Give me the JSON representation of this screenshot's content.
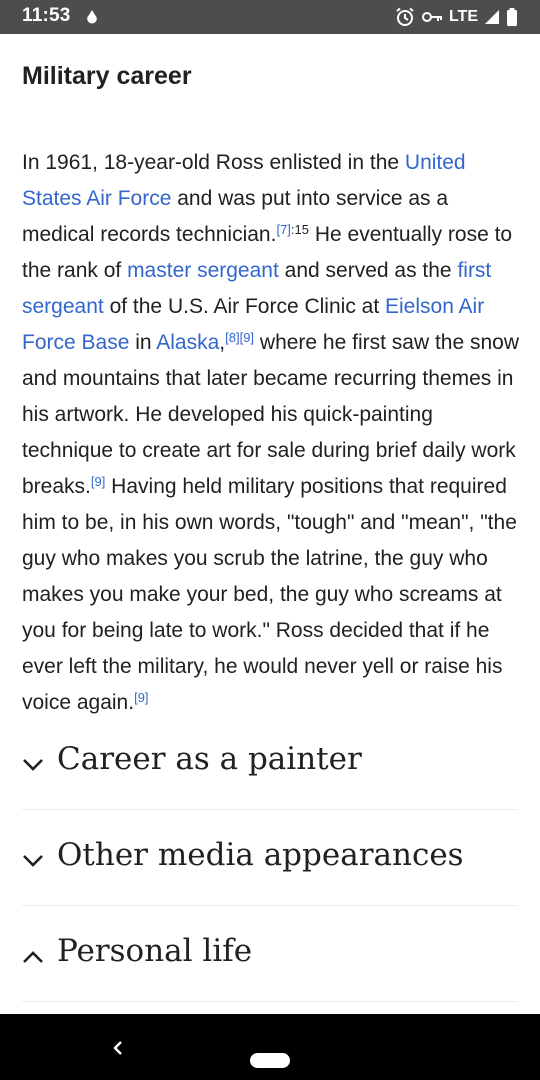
{
  "status_bar": {
    "time": "11:53",
    "network": "LTE",
    "icons": [
      "notification-dot-icon",
      "alarm-icon",
      "vpn-key-icon",
      "signal-icon",
      "battery-icon"
    ]
  },
  "article": {
    "section_title": "Military career",
    "paragraph": {
      "t1": "In 1961, 18-year-old Ross enlisted in the ",
      "l1": "United States Air Force",
      "t2": " and was put into service as a medical records technician.",
      "r1": "[7]",
      "r1_page": ":15",
      "t3": " He eventually rose to the rank of ",
      "l2": "master sergeant",
      "t4": " and served as the ",
      "l3": "first sergeant",
      "t5": " of the U.S. Air Force Clinic at ",
      "l4": "Eielson Air Force Base",
      "t6": " in ",
      "l5": "Alaska",
      "t7": ",",
      "r2": "[8]",
      "r3": "[9]",
      "t8": " where he first saw the snow and mountains that later became recurring themes in his artwork. He developed his quick-painting technique to create art for sale during brief daily work breaks.",
      "r4": "[9]",
      "t9": " Having held military positions that required him to be, in his own words, \"tough\" and \"mean\", \"the guy who makes you scrub the latrine, the guy who makes you make your bed, the guy who screams at you for being late to work.\" Ross decided that if he ever left the military, he would never yell or raise his voice again.",
      "r5": "[9]"
    }
  },
  "sections": [
    {
      "title": "Career as a painter",
      "expanded": false
    },
    {
      "title": "Other media appearances",
      "expanded": false
    },
    {
      "title": "Personal life",
      "expanded": true
    }
  ],
  "colors": {
    "link": "#3366cc",
    "text": "#202122",
    "status_bar": "#4d4d4d",
    "nav_bar": "#000000",
    "divider": "#eaecf0"
  }
}
